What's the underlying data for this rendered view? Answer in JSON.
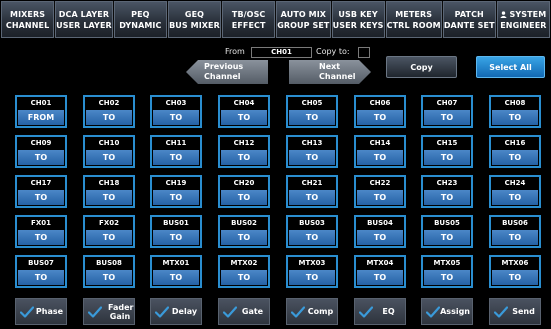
{
  "nav": {
    "tabs": [
      {
        "line1": "MIXERS",
        "line2": "CHANNEL"
      },
      {
        "line1": "DCA LAYER",
        "line2": "USER LAYER"
      },
      {
        "line1": "PEQ",
        "line2": "DYNAMIC"
      },
      {
        "line1": "GEQ",
        "line2": "BUS MIXER"
      },
      {
        "line1": "TB/OSC",
        "line2": "EFFECT"
      },
      {
        "line1": "AUTO MIX",
        "line2": "GROUP SET"
      },
      {
        "line1": "USB KEY",
        "line2": "USER KEYS"
      },
      {
        "line1": "METERS",
        "line2": "CTRL ROOM"
      },
      {
        "line1": "PATCH",
        "line2": "DANTE SET"
      },
      {
        "line1": "SYSTEM",
        "line2": "ENGINEER"
      }
    ]
  },
  "copy_panel": {
    "from_label": "From",
    "from_value": "CH01",
    "copy_to_label": "Copy to:",
    "prev_line1": "Previous",
    "prev_line2": "Channel",
    "next_line1": "Next",
    "next_line2": "Channel",
    "copy_button": "Copy",
    "select_all_button": "Select All"
  },
  "channels": [
    {
      "name": "CH01",
      "action": "FROM"
    },
    {
      "name": "CH02",
      "action": "TO"
    },
    {
      "name": "CH03",
      "action": "TO"
    },
    {
      "name": "CH04",
      "action": "TO"
    },
    {
      "name": "CH05",
      "action": "TO"
    },
    {
      "name": "CH06",
      "action": "TO"
    },
    {
      "name": "CH07",
      "action": "TO"
    },
    {
      "name": "CH08",
      "action": "TO"
    },
    {
      "name": "CH09",
      "action": "TO"
    },
    {
      "name": "CH10",
      "action": "TO"
    },
    {
      "name": "CH11",
      "action": "TO"
    },
    {
      "name": "CH12",
      "action": "TO"
    },
    {
      "name": "CH13",
      "action": "TO"
    },
    {
      "name": "CH14",
      "action": "TO"
    },
    {
      "name": "CH15",
      "action": "TO"
    },
    {
      "name": "CH16",
      "action": "TO"
    },
    {
      "name": "CH17",
      "action": "TO"
    },
    {
      "name": "CH18",
      "action": "TO"
    },
    {
      "name": "CH19",
      "action": "TO"
    },
    {
      "name": "CH20",
      "action": "TO"
    },
    {
      "name": "CH21",
      "action": "TO"
    },
    {
      "name": "CH22",
      "action": "TO"
    },
    {
      "name": "CH23",
      "action": "TO"
    },
    {
      "name": "CH24",
      "action": "TO"
    },
    {
      "name": "FX01",
      "action": "TO"
    },
    {
      "name": "FX02",
      "action": "TO"
    },
    {
      "name": "BUS01",
      "action": "TO"
    },
    {
      "name": "BUS02",
      "action": "TO"
    },
    {
      "name": "BUS03",
      "action": "TO"
    },
    {
      "name": "BUS04",
      "action": "TO"
    },
    {
      "name": "BUS05",
      "action": "TO"
    },
    {
      "name": "BUS06",
      "action": "TO"
    },
    {
      "name": "BUS07",
      "action": "TO"
    },
    {
      "name": "BUS08",
      "action": "TO"
    },
    {
      "name": "MTX01",
      "action": "TO"
    },
    {
      "name": "MTX02",
      "action": "TO"
    },
    {
      "name": "MTX03",
      "action": "TO"
    },
    {
      "name": "MTX04",
      "action": "TO"
    },
    {
      "name": "MTX05",
      "action": "TO"
    },
    {
      "name": "MTX06",
      "action": "TO"
    }
  ],
  "params": [
    {
      "label": "Phase",
      "checked": true
    },
    {
      "label": "Fader Gain",
      "checked": true
    },
    {
      "label": "Delay",
      "checked": true
    },
    {
      "label": "Gate",
      "checked": true
    },
    {
      "label": "Comp",
      "checked": true
    },
    {
      "label": "EQ",
      "checked": true
    },
    {
      "label": "Assign",
      "checked": true
    },
    {
      "label": "Send",
      "checked": true
    }
  ],
  "icons": {
    "system_tab": "person-icon",
    "check": "checkmark-icon"
  },
  "colors": {
    "cell_border": "#2a8ed0",
    "action_button": "#2f6db0",
    "select_all": "#1e88d6",
    "check": "#3a9ad9"
  }
}
